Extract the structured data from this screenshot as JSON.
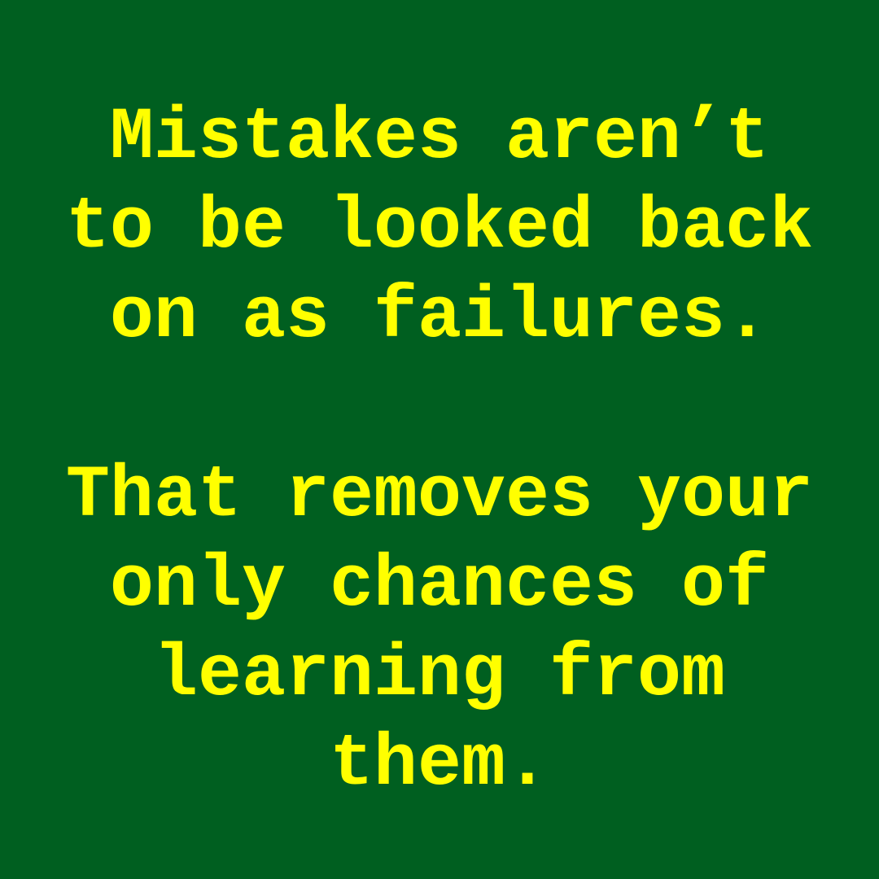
{
  "colors": {
    "background": "#005f20",
    "text": "#ffff00"
  },
  "quote": {
    "paragraph1": [
      "Mistakes aren’t",
      "to be looked back",
      "on as failures."
    ],
    "paragraph2": [
      "That removes your",
      "only chances of",
      "learning from",
      "them."
    ]
  }
}
